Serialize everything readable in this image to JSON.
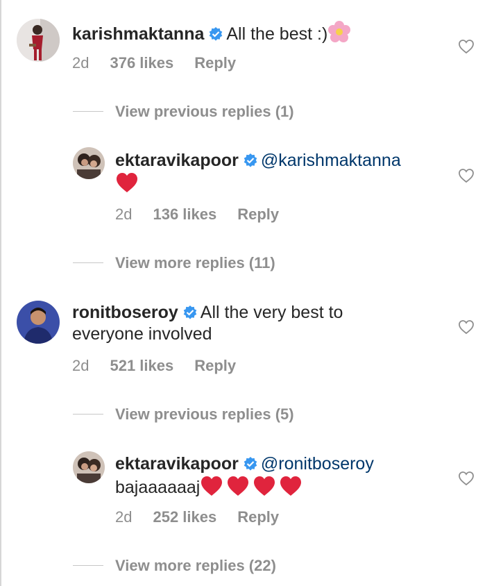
{
  "comments": [
    {
      "username": "karishmaktanna",
      "text": "All the best :)",
      "emoji": "pink-flower",
      "time": "2d",
      "likes": "376 likes",
      "reply": "Reply",
      "thread_link": "View previous replies (1)",
      "reply_item": {
        "username": "ektaravikapoor",
        "mention": "@karishmaktanna",
        "text": "",
        "time": "2d",
        "likes": "136 likes",
        "reply": "Reply",
        "thread_link": "View more replies (11)"
      }
    },
    {
      "username": "ronitboseroy",
      "text_line1": "All the very best to",
      "text_line2": "everyone involved",
      "time": "2d",
      "likes": "521 likes",
      "reply": "Reply",
      "thread_link": "View previous replies (5)",
      "reply_item": {
        "username": "ektaravikapoor",
        "mention": "@ronitboseroy",
        "text": "bajaaaaaaj",
        "time": "2d",
        "likes": "252 likes",
        "reply": "Reply",
        "thread_link": "View more replies (22)"
      }
    }
  ],
  "icons": {
    "verified": "verified-badge-icon",
    "like": "heart-outline-icon",
    "red_heart": "red-heart-emoji"
  },
  "colors": {
    "verified": "#3897f0",
    "mention": "#00376b",
    "secondary_text": "#8e8e8e",
    "red_heart": "#e0243d"
  }
}
